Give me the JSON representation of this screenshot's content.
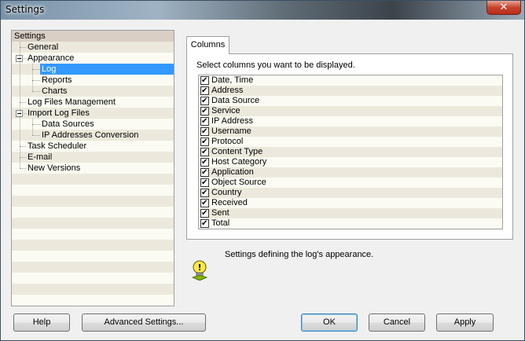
{
  "window": {
    "title": "Settings",
    "close_glyph": "✕"
  },
  "tree": {
    "items": [
      {
        "label": "Settings",
        "level": 0,
        "expandable": false,
        "selected": false
      },
      {
        "label": "General",
        "level": 1,
        "expandable": false,
        "selected": false
      },
      {
        "label": "Appearance",
        "level": 1,
        "expandable": true,
        "selected": false
      },
      {
        "label": "Log",
        "level": 2,
        "expandable": false,
        "selected": true
      },
      {
        "label": "Reports",
        "level": 2,
        "expandable": false,
        "selected": false
      },
      {
        "label": "Charts",
        "level": 2,
        "expandable": false,
        "selected": false
      },
      {
        "label": "Log Files Management",
        "level": 1,
        "expandable": false,
        "selected": false
      },
      {
        "label": "Import Log Files",
        "level": 1,
        "expandable": true,
        "selected": false
      },
      {
        "label": "Data Sources",
        "level": 2,
        "expandable": false,
        "selected": false
      },
      {
        "label": "IP Addresses Conversion",
        "level": 2,
        "expandable": false,
        "selected": false
      },
      {
        "label": "Task Scheduler",
        "level": 1,
        "expandable": false,
        "selected": false
      },
      {
        "label": "E-mail",
        "level": 1,
        "expandable": false,
        "selected": false
      },
      {
        "label": "New Versions",
        "level": 1,
        "expandable": false,
        "selected": false
      }
    ]
  },
  "columns_tab": {
    "label": "Columns",
    "description": "Select columns you want to be displayed.",
    "items": [
      {
        "label": "Date, Time",
        "checked": true
      },
      {
        "label": "Address",
        "checked": true
      },
      {
        "label": "Data Source",
        "checked": true
      },
      {
        "label": "Service",
        "checked": true
      },
      {
        "label": "IP Address",
        "checked": true
      },
      {
        "label": "Username",
        "checked": true
      },
      {
        "label": "Protocol",
        "checked": true
      },
      {
        "label": "Content Type",
        "checked": true
      },
      {
        "label": "Host Category",
        "checked": true
      },
      {
        "label": "Application",
        "checked": true
      },
      {
        "label": "Object Source",
        "checked": true
      },
      {
        "label": "Country",
        "checked": true
      },
      {
        "label": "Received",
        "checked": true
      },
      {
        "label": "Sent",
        "checked": true
      },
      {
        "label": "Total",
        "checked": true
      }
    ]
  },
  "info": {
    "text": "Settings defining the log's appearance.",
    "icon": "info-bulb-icon"
  },
  "buttons": {
    "help": "Help",
    "advanced": "Advanced Settings...",
    "ok": "OK",
    "cancel": "Cancel",
    "apply": "Apply"
  }
}
